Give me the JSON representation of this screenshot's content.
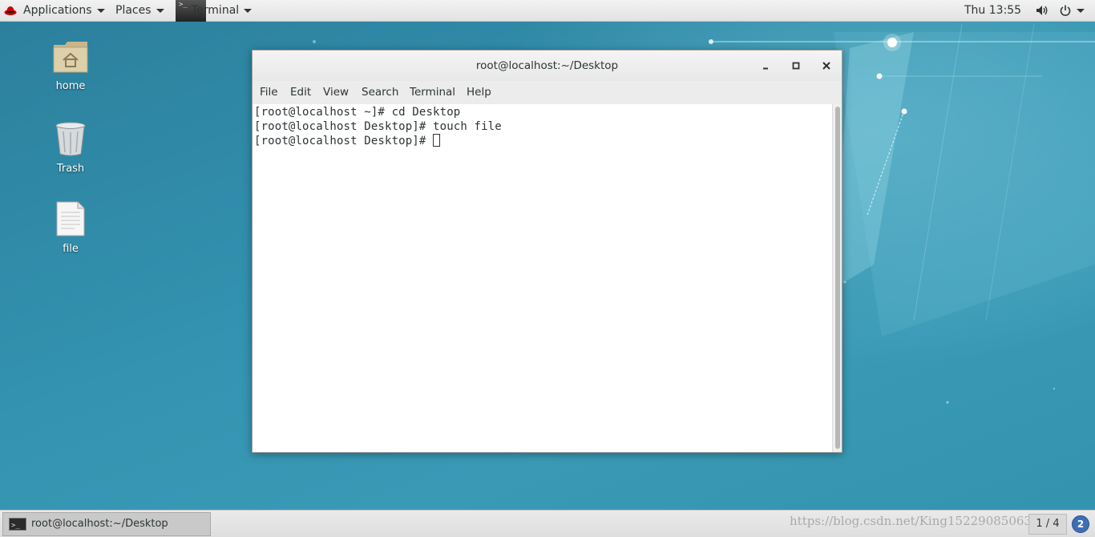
{
  "topbar": {
    "applications_label": "Applications",
    "places_label": "Places",
    "terminal_label": "Terminal",
    "clock": "Thu 13:55"
  },
  "desktop_icons": [
    {
      "label": "home",
      "icon": "home-folder-icon"
    },
    {
      "label": "Trash",
      "icon": "trash-icon"
    },
    {
      "label": "file",
      "icon": "text-file-icon"
    }
  ],
  "window": {
    "title": "root@localhost:~/Desktop",
    "menu": [
      "File",
      "Edit",
      "View",
      "Search",
      "Terminal",
      "Help"
    ],
    "lines": [
      "[root@localhost ~]# cd Desktop",
      "[root@localhost Desktop]# touch file",
      "[root@localhost Desktop]# "
    ]
  },
  "bottombar": {
    "task_label": "root@localhost:~/Desktop",
    "watermark": "https://blog.csdn.net/King15229085063",
    "workspace": "1 / 4",
    "notifications": "2"
  },
  "colors": {
    "desktop_bg": "#2f8aa6",
    "panel_bg": "#e8e8e8",
    "notification_badge": "#3d6fb3"
  }
}
